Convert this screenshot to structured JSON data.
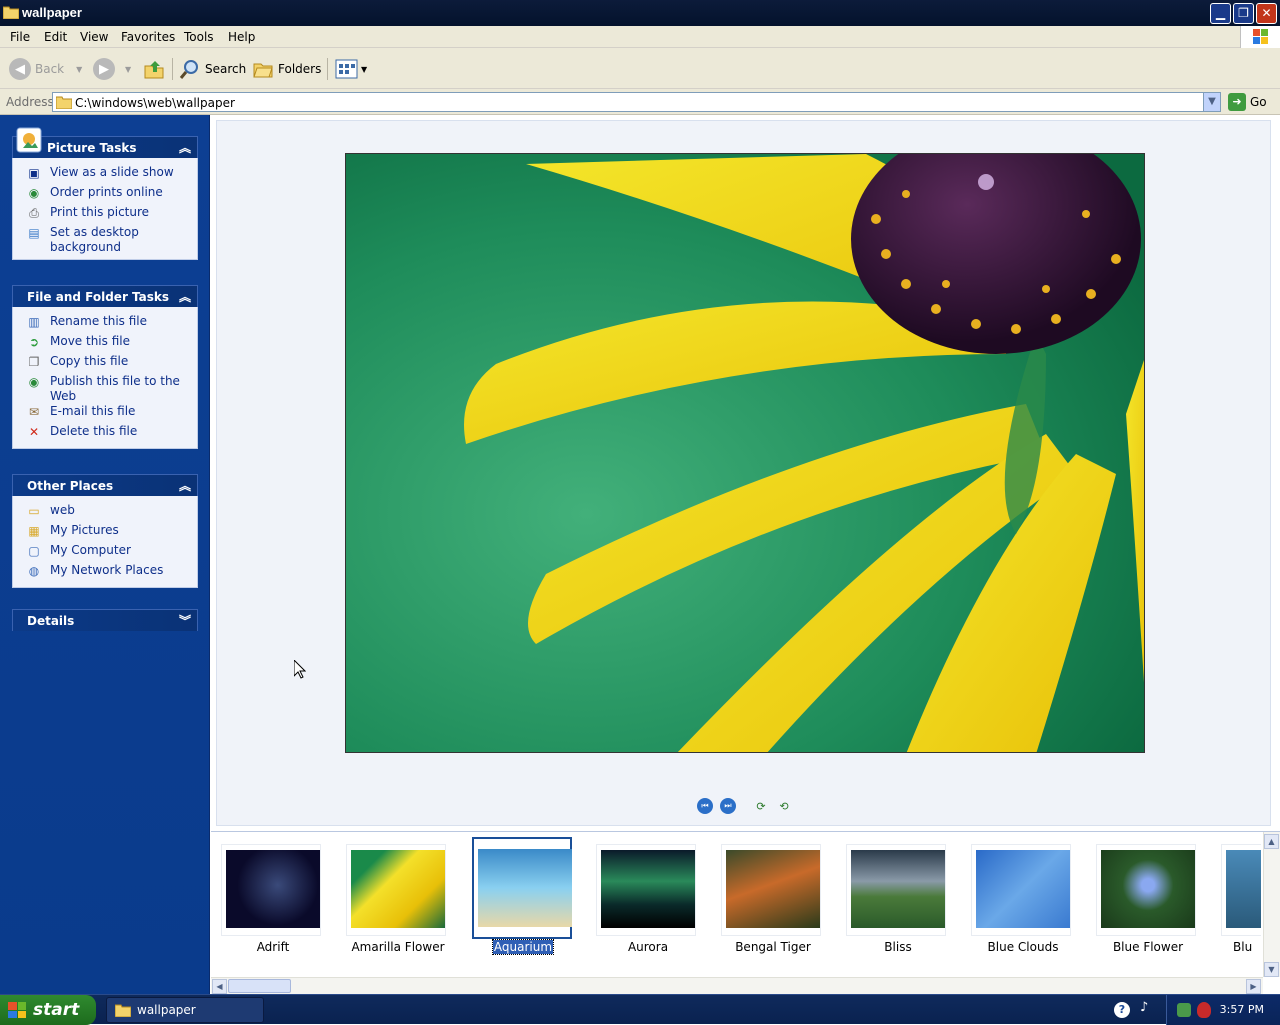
{
  "window": {
    "title": "wallpaper",
    "min": "▁",
    "max": "❐",
    "close": "✕"
  },
  "menu": [
    "File",
    "Edit",
    "View",
    "Favorites",
    "Tools",
    "Help"
  ],
  "toolbar": {
    "back": "Back",
    "search": "Search",
    "folders": "Folders"
  },
  "address": {
    "label": "Address",
    "value": "C:\\windows\\web\\wallpaper",
    "go": "Go"
  },
  "picture_tasks": {
    "title": "Picture Tasks",
    "items": [
      "View as a slide show",
      "Order prints online",
      "Print this picture",
      "Set as desktop background"
    ]
  },
  "file_tasks": {
    "title": "File and Folder Tasks",
    "items": [
      "Rename this file",
      "Move this file",
      "Copy this file",
      "Publish this file to the Web",
      "E-mail this file",
      "Delete this file"
    ]
  },
  "other_places": {
    "title": "Other Places",
    "items": [
      "web",
      "My Pictures",
      "My Computer",
      "My Network Places"
    ]
  },
  "details": {
    "title": "Details"
  },
  "filmstrip": {
    "thumbs": [
      "Adrift",
      "Amarilla Flower",
      "Aquarium",
      "Aurora",
      "Bengal Tiger",
      "Bliss",
      "Blue Clouds",
      "Blue Flower",
      "Blu"
    ],
    "selected": "Aquarium"
  },
  "taskbar": {
    "start": "start",
    "window": "wallpaper",
    "clock": "3:57 PM"
  },
  "icons": {
    "chev_up": "⌃",
    "chev_down": "⌄",
    "back": "back-arrow-icon",
    "forward": "forward-arrow-icon"
  }
}
